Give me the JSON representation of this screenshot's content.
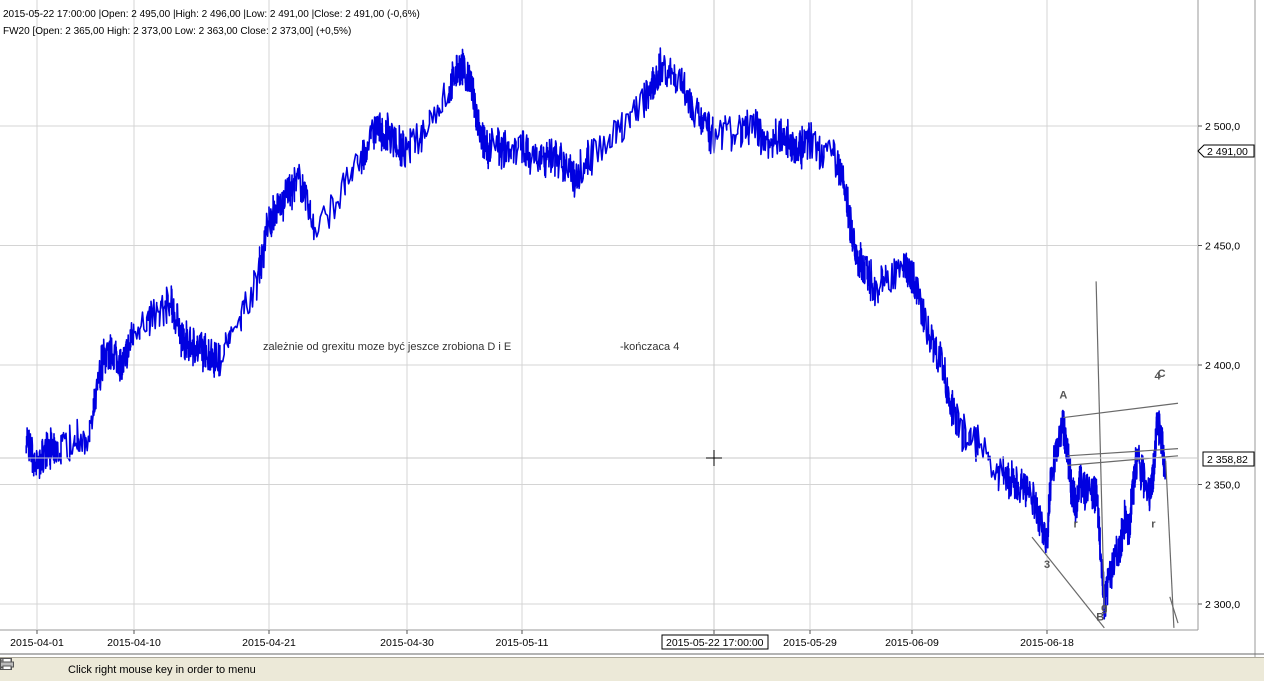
{
  "header": {
    "line1": "2015-05-22 17:00:00 |Open: 2 495,00 |High: 2 496,00 |Low: 2 491,00 |Close: 2 491,00 (-0,6%)",
    "line2": "FW20 [Open: 2 365,00  High: 2 373,00  Low: 2 363,00  Close: 2 373,00] (+0,5%)"
  },
  "annotations": {
    "note1": "zależnie od grexitu moze być jeszce zrobiona D i E",
    "note2": "-kończaca 4"
  },
  "cursor": {
    "date_label": "2015-05-22 17:00:00",
    "price_label": "2 358,82"
  },
  "last_price_label": "2 491,00",
  "status": {
    "hint": "Click right mouse key in order to menu",
    "icons": [
      "checkbox-icon",
      "settings-icon",
      "print-icon"
    ]
  },
  "colors": {
    "price_line": "#0000e0",
    "grid": "#d4d4d4",
    "trendline": "#6a6a6a"
  },
  "chart_data": {
    "type": "line",
    "x_type": "date",
    "x_ticks": [
      "2015-04-01",
      "2015-04-10",
      "2015-04-21",
      "2015-04-30",
      "2015-05-11",
      "2015-05-22",
      "2015-05-29",
      "2015-06-09",
      "2015-06-18"
    ],
    "y_ticks": [
      2300,
      2350,
      2400,
      2450,
      2500
    ],
    "y_tick_labels": [
      "2 300,0",
      "2 350,0",
      "2 400,0",
      "2 450,0",
      "2 500,0"
    ],
    "ylim": [
      2290,
      2535
    ],
    "grid": true,
    "series": [
      {
        "points": [
          [
            "2015-03-31",
            2370
          ],
          [
            "2015-04-01",
            2358
          ],
          [
            "2015-04-02",
            2365
          ],
          [
            "2015-04-03",
            2364
          ],
          [
            "2015-04-06",
            2372
          ],
          [
            "2015-04-07",
            2402
          ],
          [
            "2015-04-08",
            2405
          ],
          [
            "2015-04-09",
            2400
          ],
          [
            "2015-04-10",
            2415
          ],
          [
            "2015-04-13",
            2425
          ],
          [
            "2015-04-14",
            2410
          ],
          [
            "2015-04-15",
            2408
          ],
          [
            "2015-04-16",
            2405
          ],
          [
            "2015-04-17",
            2402
          ],
          [
            "2015-04-20",
            2435
          ],
          [
            "2015-04-21",
            2460
          ],
          [
            "2015-04-22",
            2470
          ],
          [
            "2015-04-23",
            2478
          ],
          [
            "2015-04-24",
            2455
          ],
          [
            "2015-04-27",
            2485
          ],
          [
            "2015-04-28",
            2500
          ],
          [
            "2015-04-29",
            2495
          ],
          [
            "2015-04-30",
            2488
          ],
          [
            "2015-05-04",
            2515
          ],
          [
            "2015-05-05",
            2525
          ],
          [
            "2015-05-06",
            2520
          ],
          [
            "2015-05-07",
            2495
          ],
          [
            "2015-05-08",
            2490
          ],
          [
            "2015-05-11",
            2492
          ],
          [
            "2015-05-12",
            2485
          ],
          [
            "2015-05-13",
            2488
          ],
          [
            "2015-05-14",
            2478
          ],
          [
            "2015-05-15",
            2488
          ],
          [
            "2015-05-18",
            2510
          ],
          [
            "2015-05-19",
            2525
          ],
          [
            "2015-05-20",
            2520
          ],
          [
            "2015-05-21",
            2505
          ],
          [
            "2015-05-22",
            2495
          ],
          [
            "2015-05-25",
            2500
          ],
          [
            "2015-05-26",
            2493
          ],
          [
            "2015-05-27",
            2496
          ],
          [
            "2015-05-28",
            2490
          ],
          [
            "2015-05-29",
            2493
          ],
          [
            "2015-06-01",
            2485
          ],
          [
            "2015-06-02",
            2468
          ],
          [
            "2015-06-03",
            2445
          ],
          [
            "2015-06-04",
            2440
          ],
          [
            "2015-06-05",
            2432
          ],
          [
            "2015-06-08",
            2441
          ],
          [
            "2015-06-09",
            2438
          ],
          [
            "2015-06-10",
            2415
          ],
          [
            "2015-06-11",
            2400
          ],
          [
            "2015-06-12",
            2375
          ],
          [
            "2015-06-15",
            2355
          ],
          [
            "2015-06-16",
            2350
          ],
          [
            "2015-06-17",
            2345
          ],
          [
            "2015-06-18",
            2325
          ],
          [
            "2015-06-19",
            2355
          ],
          [
            "2015-06-22",
            2375
          ],
          [
            "2015-06-23",
            2365
          ],
          [
            "2015-06-24",
            2348
          ],
          [
            "2015-06-25",
            2340
          ],
          [
            "2015-06-26",
            2350
          ],
          [
            "2015-06-29",
            2345
          ],
          [
            "2015-06-30",
            2348
          ],
          [
            "2015-07-01",
            2325
          ],
          [
            "2015-07-02",
            2300
          ],
          [
            "2015-07-03",
            2310
          ],
          [
            "2015-07-06",
            2325
          ],
          [
            "2015-07-07",
            2335
          ],
          [
            "2015-07-08",
            2330
          ],
          [
            "2015-07-09",
            2348
          ],
          [
            "2015-07-10",
            2362
          ],
          [
            "2015-07-13",
            2345
          ],
          [
            "2015-07-14",
            2355
          ],
          [
            "2015-07-15",
            2378
          ],
          [
            "2015-07-16",
            2368
          ],
          [
            "2015-07-17",
            2355
          ]
        ]
      }
    ],
    "overlay_lines": [
      {
        "from": [
          "2015-06-17",
          2328
        ],
        "to": [
          "2015-07-02",
          2290
        ]
      },
      {
        "from": [
          "2015-06-22",
          2378
        ],
        "to": [
          "2015-07-20",
          2384
        ]
      },
      {
        "from": [
          "2015-06-23",
          2362
        ],
        "to": [
          "2015-07-20",
          2365
        ]
      },
      {
        "from": [
          "2015-06-23",
          2358
        ],
        "to": [
          "2015-07-20",
          2362
        ]
      },
      {
        "from": [
          "2015-06-30",
          2435
        ],
        "to": [
          "2015-07-02",
          2298
        ]
      },
      {
        "from": [
          "2015-07-17",
          2360
        ],
        "to": [
          "2015-07-19",
          2290
        ]
      },
      {
        "from": [
          "2015-07-18",
          2303
        ],
        "to": [
          "2015-07-20",
          2292
        ]
      }
    ],
    "wave_labels": [
      {
        "text": "3",
        "date": "2015-06-18",
        "value": 2315
      },
      {
        "text": "A",
        "date": "2015-06-22",
        "value": 2386
      },
      {
        "text": "r",
        "date": "2015-06-25",
        "value": 2332
      },
      {
        "text": "B",
        "date": "2015-07-01",
        "value": 2293
      },
      {
        "text": "g",
        "date": "2015-07-02",
        "value": 2297
      },
      {
        "text": "r",
        "date": "2015-07-14",
        "value": 2332
      },
      {
        "text": "4",
        "date": "2015-07-15",
        "value": 2394
      },
      {
        "text": "C",
        "date": "2015-07-16",
        "value": 2395
      }
    ]
  }
}
